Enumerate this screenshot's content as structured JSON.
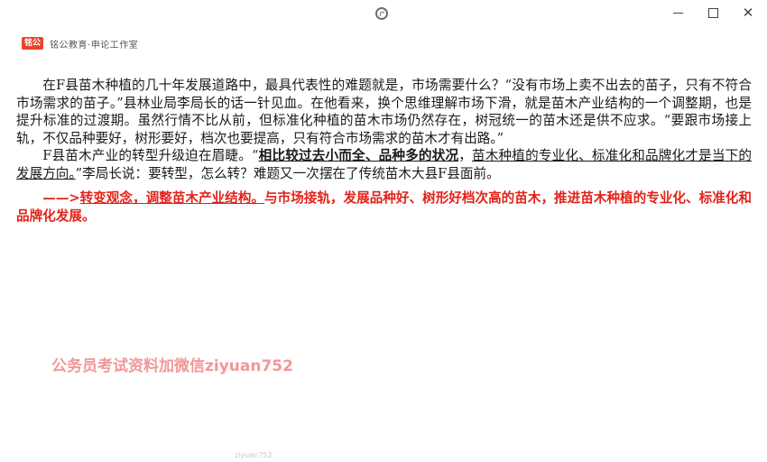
{
  "window": {
    "loading_icon": "spinner-icon",
    "minimize_icon": "minimize-icon",
    "maximize_icon": "maximize-icon",
    "close_label": "✕"
  },
  "brand": {
    "logo_text": "铭公",
    "name": "铭公教育·申论工作室"
  },
  "passage": {
    "p1": "在F县苗木种植的几十年发展道路中，最具代表性的难题就是，市场需要什么？“没有市场上卖不出去的苗子，只有不符合市场需求的苗子。”县林业局李局长的话一针见血。在他看来，换个思维理解市场下滑，就是苗木产业结构的一个调整期，也是提升标准的过渡期。虽然行情不比从前，但标准化种植的苗木市场仍然存在，树冠统一的苗木还是供不应求。“要跟市场接上轨，不仅品种要好，树形要好，档次也要提高，只有符合市场需求的苗木才有出路。”",
    "p2_start": "F县苗木产业的转型升级迫在眉睫。“",
    "p2_bold": "相比较过去小而全、品种多的状况",
    "p2_comma": "，",
    "p2_underlined": "苗木种植的专业化、标准化和品牌化才是当下的发展方向。",
    "p2_end": "”李局长说：要转型，怎么转？难题又一次摆在了传统苗木大县F县面前。"
  },
  "answer": {
    "prefix": "——>",
    "underlined": "转变观念，调整苗木产业结构。",
    "rest": "与市场接轨，发展品种好、树形好档次高的苗木，推进苗木种植的专业化、标准化和品牌化发展。"
  },
  "watermark": "公务员考试资料加微信ziyuan752",
  "footer_note": "ziyuan752"
}
